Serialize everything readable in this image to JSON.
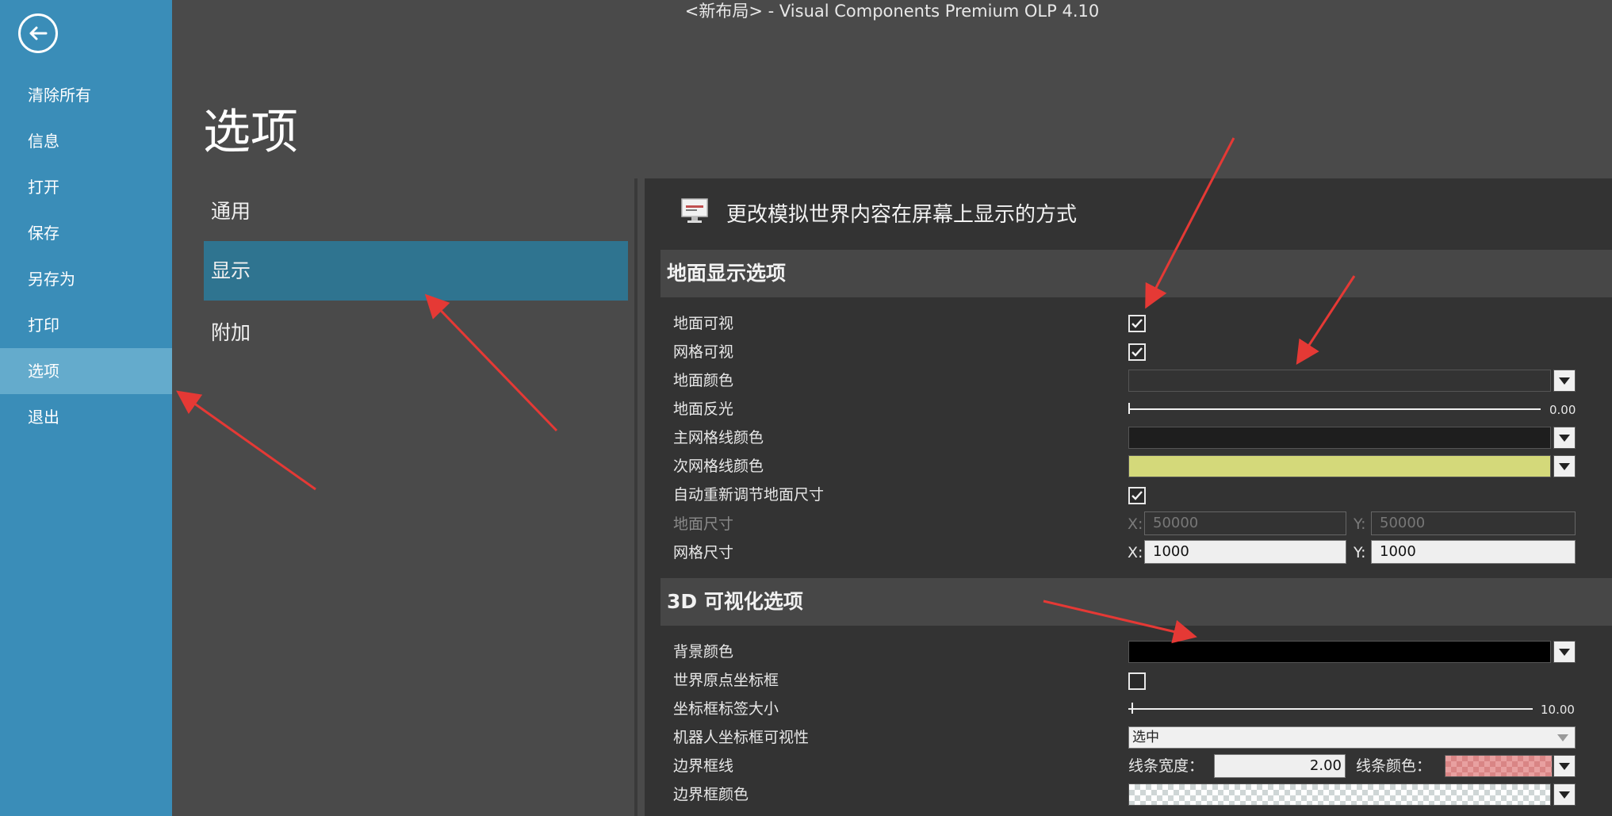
{
  "window": {
    "title": "<新布局> - Visual Components Premium OLP 4.10"
  },
  "sidebar": {
    "items": [
      {
        "label": "清除所有"
      },
      {
        "label": "信息"
      },
      {
        "label": "打开"
      },
      {
        "label": "保存"
      },
      {
        "label": "另存为"
      },
      {
        "label": "打印"
      },
      {
        "label": "选项",
        "active": true
      },
      {
        "label": "退出"
      }
    ]
  },
  "page": {
    "title": "选项"
  },
  "categories": [
    {
      "label": "通用"
    },
    {
      "label": "显示",
      "active": true
    },
    {
      "label": "附加"
    }
  ],
  "panel": {
    "subtitle": "更改模拟世界内容在屏幕上显示的方式",
    "ground_section": {
      "title": "地面显示选项",
      "ground_visible": {
        "label": "地面可视",
        "checked": true
      },
      "grid_visible": {
        "label": "网格可视",
        "checked": true
      },
      "ground_color": {
        "label": "地面颜色",
        "color": "#333333"
      },
      "ground_reflection": {
        "label": "地面反光",
        "value": "0.00"
      },
      "major_grid_color": {
        "label": "主网格线颜色",
        "color": "#1e1e1e"
      },
      "minor_grid_color": {
        "label": "次网格线颜色",
        "color": "#d4d97a"
      },
      "auto_resize": {
        "label": "自动重新调节地面尺寸",
        "checked": true
      },
      "ground_size": {
        "label": "地面尺寸",
        "x_label": "X:",
        "x": "50000",
        "y_label": "Y:",
        "y": "50000"
      },
      "grid_size": {
        "label": "网格尺寸",
        "x_label": "X:",
        "x": "1000",
        "y_label": "Y:",
        "y": "1000"
      }
    },
    "viz_section": {
      "title": "3D 可视化选项",
      "background_color": {
        "label": "背景颜色",
        "color": "#000000"
      },
      "world_origin_frame": {
        "label": "世界原点坐标框",
        "checked": false
      },
      "frame_label_size": {
        "label": "坐标框标签大小",
        "value": "10.00"
      },
      "robot_frame_visibility": {
        "label": "机器人坐标框可视性",
        "value": "选中"
      },
      "bounding_box_line": {
        "label": "边界框线",
        "width_label": "线条宽度：",
        "width_value": "2.00",
        "color_label": "线条颜色："
      },
      "bounding_box_color": {
        "label": "边界框颜色"
      }
    }
  },
  "colors": {
    "sidebar": "#3a8db8",
    "sidebar_active": "#64abcc",
    "category_active": "#2f7490",
    "annotation_arrow": "#e53935"
  },
  "icons": {
    "back": "back-arrow-icon",
    "monitor": "monitor-icon",
    "check": "checkmark-icon",
    "dropdown": "chevron-down-icon"
  }
}
